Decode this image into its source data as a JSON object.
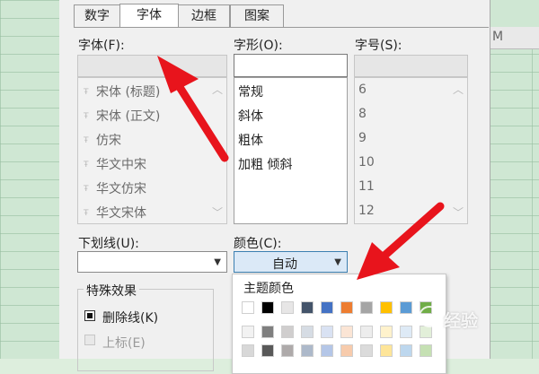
{
  "sheet": {
    "column_letter": "M"
  },
  "tabs": [
    {
      "label": "数字",
      "active": false
    },
    {
      "label": "字体",
      "active": true
    },
    {
      "label": "边框",
      "active": false
    },
    {
      "label": "图案",
      "active": false
    }
  ],
  "font": {
    "label": "字体(F):",
    "value": "",
    "items": [
      "宋体 (标题)",
      "宋体 (正文)",
      "仿宋",
      "华文中宋",
      "华文仿宋",
      "华文宋体"
    ]
  },
  "style": {
    "label": "字形(O):",
    "value": "",
    "items": [
      "常规",
      "斜体",
      "粗体",
      "加粗 倾斜"
    ]
  },
  "size": {
    "label": "字号(S):",
    "value": "",
    "items": [
      "6",
      "8",
      "9",
      "10",
      "11",
      "12"
    ]
  },
  "underline": {
    "label": "下划线(U):",
    "value": ""
  },
  "color": {
    "label": "颜色(C):",
    "value": "自动"
  },
  "effects": {
    "title": "特殊效果",
    "strikethrough": {
      "label": "删除线(K)",
      "checked": true
    },
    "superscript": {
      "label": "上标(E)",
      "checked": false
    }
  },
  "palette": {
    "title": "主题颜色",
    "theme_row": [
      "#ffffff",
      "#000000",
      "#e7e6e6",
      "#44546a",
      "#4472c4",
      "#ed7d31",
      "#a5a5a5",
      "#ffc000",
      "#5b9bd5",
      "#70ad47"
    ],
    "tint_row1": [
      "#f2f2f2",
      "#7f7f7f",
      "#d0cece",
      "#d6dce4",
      "#d9e2f3",
      "#fbe5d5",
      "#ededed",
      "#fff2cc",
      "#deeaf6",
      "#e2efd9"
    ],
    "tint_row2": [
      "#d8d8d8",
      "#595959",
      "#aeaaaa",
      "#adb9ca",
      "#b4c6e7",
      "#f7cbac",
      "#dbdbdb",
      "#fee599",
      "#bdd7ee",
      "#c5e0b3"
    ]
  },
  "watermark": {
    "text": "经验"
  },
  "colors": {
    "arrow": "#e8141c",
    "accent": "#3c7fb1"
  }
}
